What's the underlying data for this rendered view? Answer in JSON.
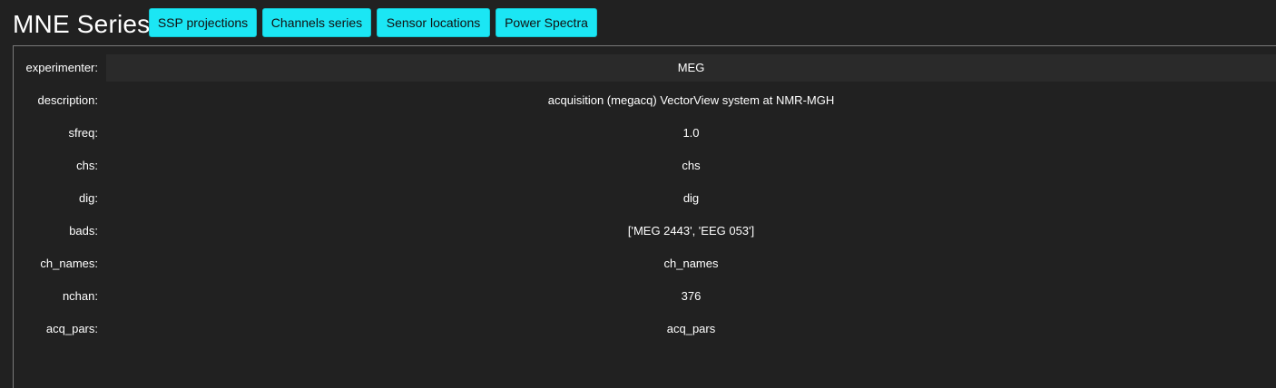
{
  "header": {
    "title": "MNE Series",
    "buttons": [
      {
        "label": "SSP projections"
      },
      {
        "label": "Channels series"
      },
      {
        "label": "Sensor locations"
      },
      {
        "label": "Power Spectra"
      }
    ]
  },
  "info": {
    "rows": [
      {
        "label": "experimenter:",
        "value": "MEG"
      },
      {
        "label": "description:",
        "value": "acquisition (megacq) VectorView system at NMR-MGH"
      },
      {
        "label": "sfreq:",
        "value": "1.0"
      },
      {
        "label": "chs:",
        "value": "chs"
      },
      {
        "label": "dig:",
        "value": "dig"
      },
      {
        "label": "bads:",
        "value": "['MEG 2443', 'EEG 053']"
      },
      {
        "label": "ch_names:",
        "value": "ch_names"
      },
      {
        "label": "nchan:",
        "value": "376"
      },
      {
        "label": "acq_pars:",
        "value": "acq_pars"
      }
    ]
  },
  "colors": {
    "background": "#212121",
    "button_accent": "#1be6f4",
    "input_background": "#2a2a2a"
  }
}
